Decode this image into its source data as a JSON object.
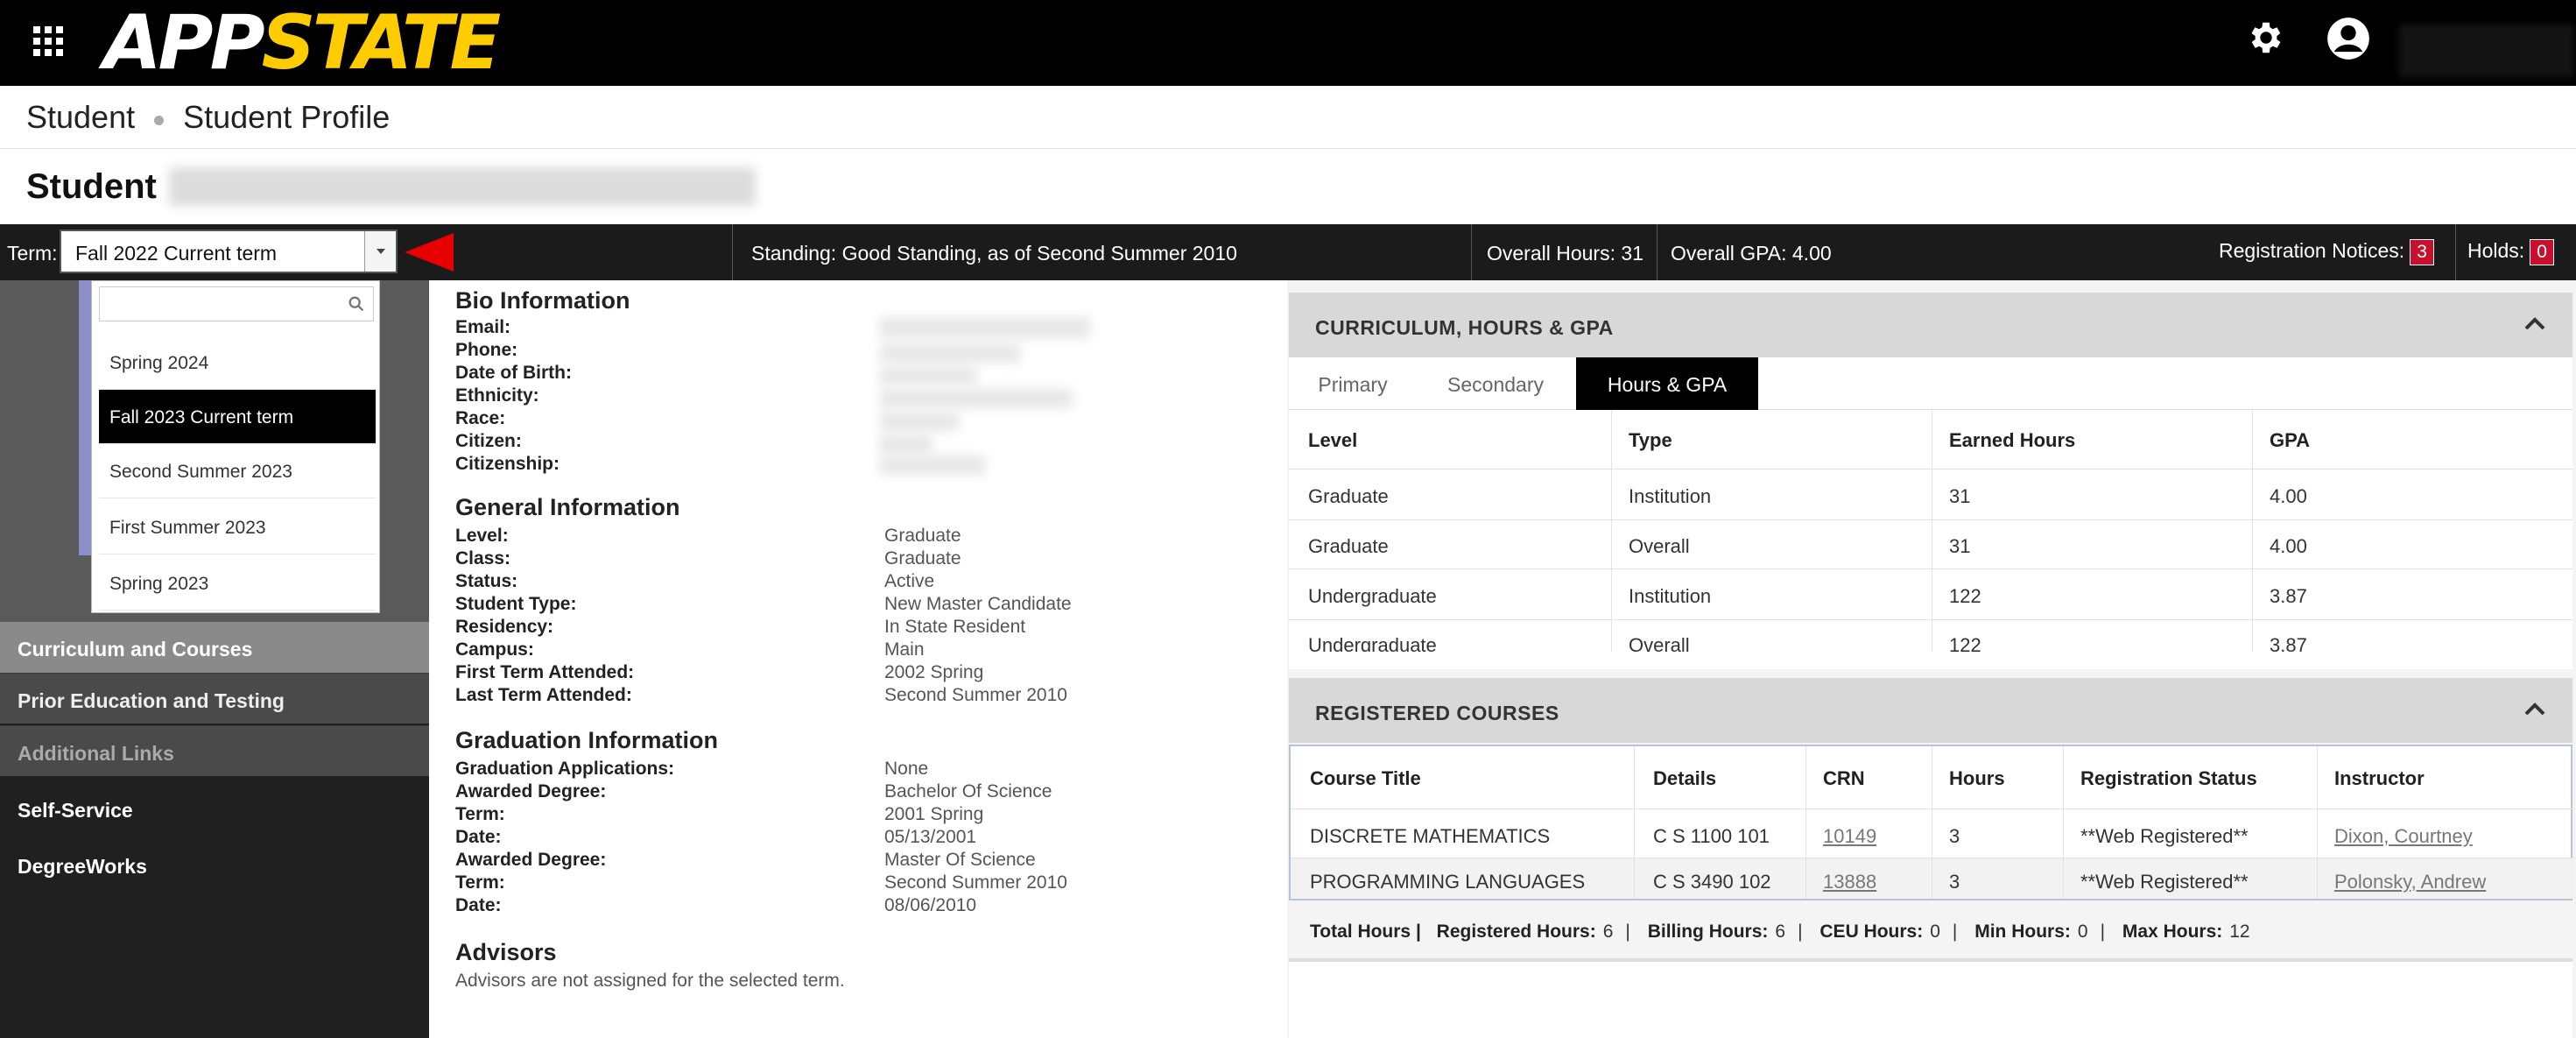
{
  "header": {
    "logo_app": "APP",
    "logo_state": "STATE"
  },
  "breadcrumb": {
    "item1": "Student",
    "item2": "Student Profile"
  },
  "page_title": "Student",
  "termbar": {
    "label": "Term:",
    "selected": "Fall 2022 Current term",
    "standing": "Standing: Good Standing, as of Second Summer 2010",
    "overall_hours": "Overall Hours: 31",
    "overall_gpa": "Overall GPA: 4.00",
    "registration_notices_label": "Registration Notices:",
    "registration_notices_count": "3",
    "holds_label": "Holds:",
    "holds_count": "0"
  },
  "term_dropdown": {
    "options": [
      "Spring 2024",
      "Fall 2023 Current term",
      "Second Summer 2023",
      "First Summer 2023",
      "Spring 2023"
    ],
    "highlighted": "Fall 2023 Current term"
  },
  "sidebar": {
    "items": [
      "Curriculum and Courses",
      "Prior Education and Testing",
      "Additional Links",
      "Self-Service",
      "DegreeWorks"
    ]
  },
  "bio": {
    "title": "Bio Information",
    "labels": [
      "Email:",
      "Phone:",
      "Date of Birth:",
      "Ethnicity:",
      "Race:",
      "Citizen:",
      "Citizenship:"
    ]
  },
  "general": {
    "title": "General Information",
    "labels": [
      "Level:",
      "Class:",
      "Status:",
      "Student Type:",
      "Residency:",
      "Campus:",
      "First Term Attended:",
      "Last Term Attended:"
    ],
    "values": [
      "Graduate",
      "Graduate",
      "Active",
      "New Master Candidate",
      "In State Resident",
      "Main",
      "2002 Spring",
      "Second Summer 2010"
    ]
  },
  "graduation": {
    "title": "Graduation Information",
    "labels": [
      "Graduation Applications:",
      "Awarded Degree:",
      "Term:",
      "Date:",
      "Awarded Degree:",
      "Term:",
      "Date:"
    ],
    "values": [
      "None",
      "Bachelor Of Science",
      "2001 Spring",
      "05/13/2001",
      "Master Of Science",
      "Second Summer 2010",
      "08/06/2010"
    ]
  },
  "advisors": {
    "title": "Advisors",
    "note": "Advisors are not assigned for the selected term."
  },
  "curriculum": {
    "title": "CURRICULUM, HOURS & GPA",
    "tabs": [
      "Primary",
      "Secondary",
      "Hours & GPA"
    ],
    "active_tab": "Hours & GPA",
    "headers": [
      "Level",
      "Type",
      "Earned Hours",
      "GPA"
    ],
    "rows": [
      [
        "Graduate",
        "Institution",
        "31",
        "4.00"
      ],
      [
        "Graduate",
        "Overall",
        "31",
        "4.00"
      ],
      [
        "Undergraduate",
        "Institution",
        "122",
        "3.87"
      ],
      [
        "Undergraduate",
        "Overall",
        "122",
        "3.87"
      ]
    ]
  },
  "registered": {
    "title": "REGISTERED COURSES",
    "headers": [
      "Course Title",
      "Details",
      "CRN",
      "Hours",
      "Registration Status",
      "Instructor"
    ],
    "rows": [
      [
        "DISCRETE MATHEMATICS",
        "C S 1100 101",
        "10149",
        "3",
        "**Web Registered**",
        "Dixon, Courtney"
      ],
      [
        "PROGRAMMING LANGUAGES",
        "C S 3490 102",
        "13888",
        "3",
        "**Web Registered**",
        "Polonsky, Andrew"
      ]
    ],
    "totals": {
      "total_label": "Total Hours |",
      "registered_label": "Registered Hours:",
      "registered": "6",
      "billing_label": "Billing Hours:",
      "billing": "6",
      "ceu_label": "CEU Hours:",
      "ceu": "0",
      "min_label": "Min Hours:",
      "min": "0",
      "max_label": "Max Hours:",
      "max": "12"
    }
  }
}
